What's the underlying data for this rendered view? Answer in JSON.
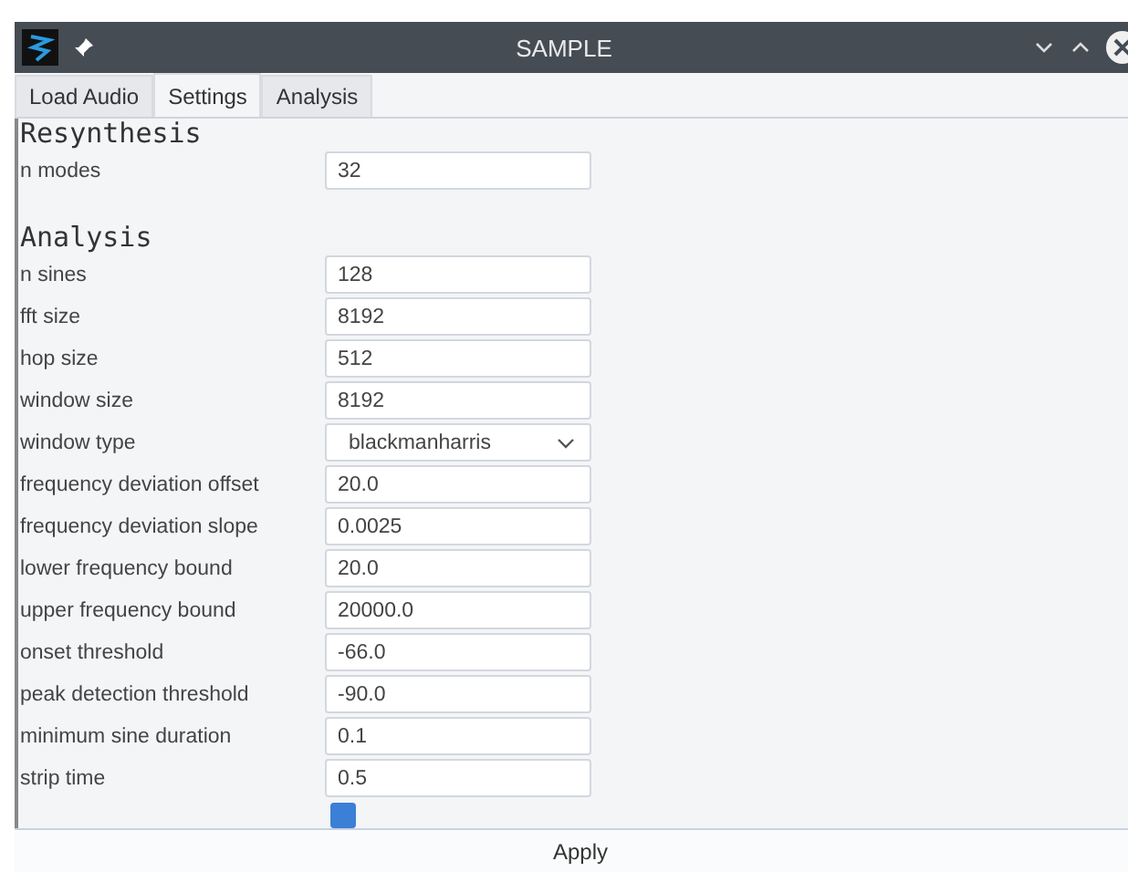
{
  "window": {
    "title": "SAMPLE"
  },
  "tabs": [
    {
      "label": "Load Audio",
      "selected": false
    },
    {
      "label": "Settings",
      "selected": true
    },
    {
      "label": "Analysis",
      "selected": false
    }
  ],
  "sections": [
    {
      "title": "Resynthesis",
      "fields": [
        {
          "kind": "text",
          "label": "n modes",
          "value": "32"
        }
      ]
    },
    {
      "title": "Analysis",
      "fields": [
        {
          "kind": "text",
          "label": "n sines",
          "value": "128"
        },
        {
          "kind": "text",
          "label": "fft size",
          "value": "8192"
        },
        {
          "kind": "text",
          "label": "hop size",
          "value": "512"
        },
        {
          "kind": "text",
          "label": "window size",
          "value": "8192"
        },
        {
          "kind": "select",
          "label": "window type",
          "value": "blackmanharris"
        },
        {
          "kind": "text",
          "label": "frequency deviation offset",
          "value": "20.0"
        },
        {
          "kind": "text",
          "label": "frequency deviation slope",
          "value": "0.0025"
        },
        {
          "kind": "text",
          "label": "lower frequency bound",
          "value": "20.0"
        },
        {
          "kind": "text",
          "label": "upper frequency bound",
          "value": "20000.0"
        },
        {
          "kind": "text",
          "label": "onset threshold",
          "value": "-66.0"
        },
        {
          "kind": "text",
          "label": "peak detection threshold",
          "value": "-90.0"
        },
        {
          "kind": "text",
          "label": "minimum sine duration",
          "value": "0.1"
        },
        {
          "kind": "text",
          "label": "strip time",
          "value": "0.5"
        },
        {
          "kind": "checkbox",
          "checked": true
        }
      ]
    }
  ],
  "apply_button": "Apply"
}
